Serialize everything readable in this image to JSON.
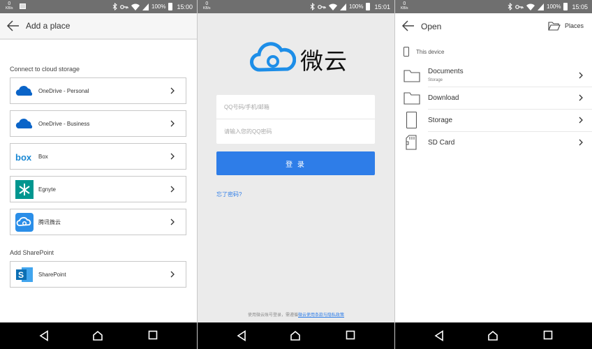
{
  "status_bars": [
    {
      "speed": "0",
      "speed_unit": "KB/s",
      "battery": "100%",
      "time": "15:00"
    },
    {
      "speed": "0",
      "speed_unit": "KB/s",
      "battery": "100%",
      "time": "15:01"
    },
    {
      "speed": "0",
      "speed_unit": "KB/s",
      "battery": "100%",
      "time": "15:05"
    }
  ],
  "screen1": {
    "title": "Add a place",
    "cloud_section": "Connect to cloud storage",
    "cloud_items": [
      {
        "label": "OneDrive - Personal",
        "icon": "onedrive-icon"
      },
      {
        "label": "OneDrive - Business",
        "icon": "onedrive-icon"
      },
      {
        "label": "Box",
        "icon": "box-icon"
      },
      {
        "label": "Egnyte",
        "icon": "egnyte-icon"
      },
      {
        "label": "腾讯微云",
        "icon": "weiyun-icon"
      }
    ],
    "sharepoint_section": "Add SharePoint",
    "sharepoint_item": {
      "label": "SharePoint",
      "icon": "sharepoint-icon"
    }
  },
  "screen2": {
    "logo_text": "微云",
    "account_placeholder": "QQ号码/手机/邮箱",
    "password_placeholder": "请输入您的QQ密码",
    "login_label": "登 录",
    "forgot_label": "忘了密码?",
    "agreement_prefix": "使用微云账号登录，需遵循",
    "agreement_link": "微云使用条款与隐私政策"
  },
  "screen3": {
    "title": "Open",
    "places_label": "Places",
    "section": "This device",
    "items": [
      {
        "name": "Documents",
        "sub": "Storage",
        "icon": "folder-icon"
      },
      {
        "name": "Download",
        "sub": "",
        "icon": "folder-icon"
      },
      {
        "name": "Storage",
        "sub": "",
        "icon": "phone-storage-icon"
      },
      {
        "name": "SD Card",
        "sub": "",
        "icon": "sd-card-icon"
      }
    ]
  },
  "colors": {
    "accent": "#2e7de8",
    "onedrive": "#0a64c8",
    "box": "#1a88d4",
    "egnyte": "#00968f",
    "sharepoint": "#0b6fb4",
    "statusbar": "#6f6f6f",
    "navbar": "#000000"
  }
}
